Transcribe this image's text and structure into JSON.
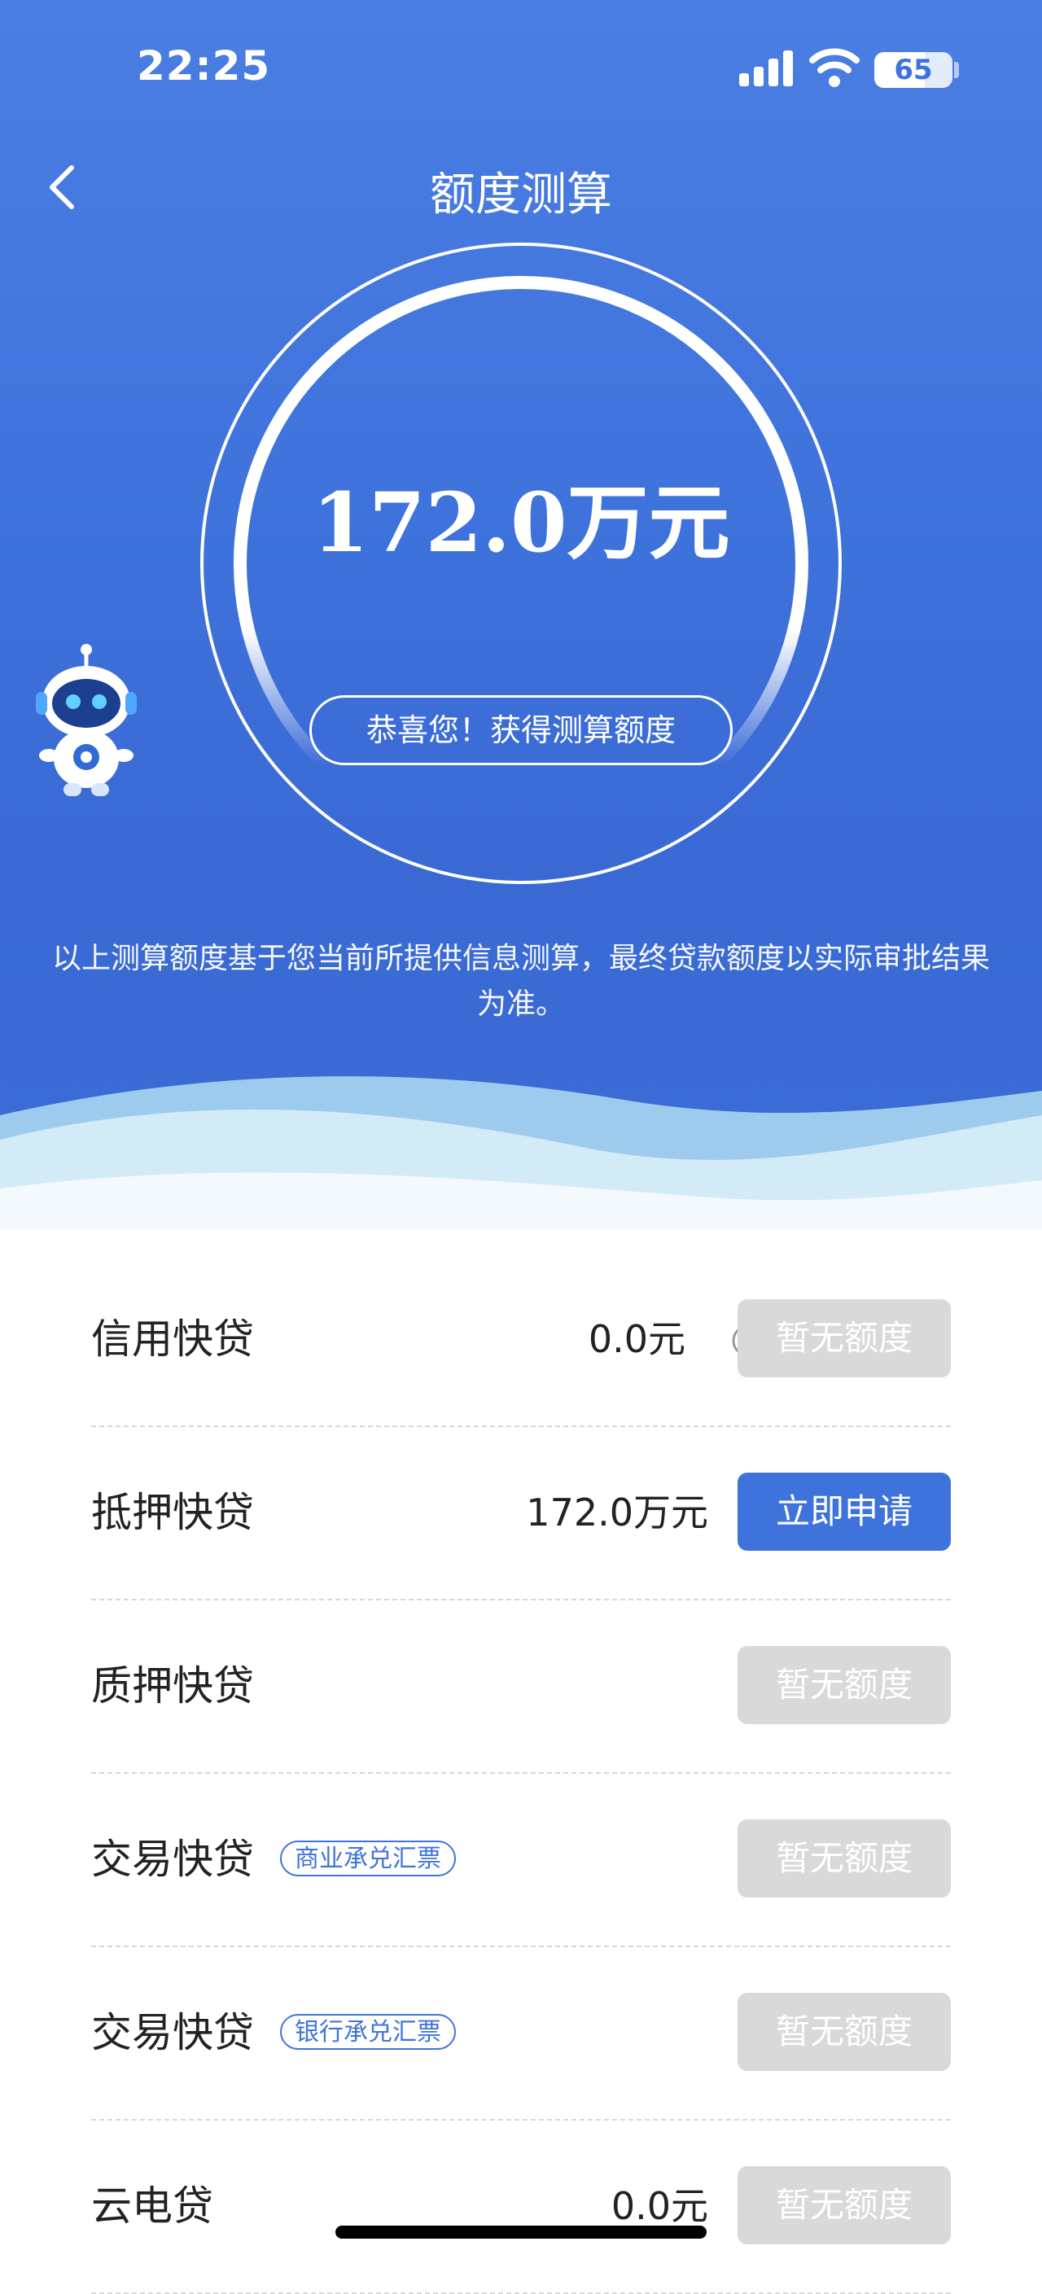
{
  "status_bar": {
    "time": "22:25",
    "battery": "65"
  },
  "nav": {
    "title": "额度测算"
  },
  "result": {
    "amount": "172.0万元",
    "message": "恭喜您！获得测算额度",
    "disclaimer": "以上测算额度基于您当前所提供信息测算，最终贷款额度以实际审批结果为准。"
  },
  "colors": {
    "primary": "#3f73dc",
    "disabled": "#d9d9d9"
  },
  "products": [
    {
      "name": "信用快贷",
      "tag": "",
      "amount": "0.0元",
      "has_info": true,
      "button": "暂无额度",
      "button_state": "disabled"
    },
    {
      "name": "抵押快贷",
      "tag": "",
      "amount": "172.0万元",
      "has_info": false,
      "button": "立即申请",
      "button_state": "primary"
    },
    {
      "name": "质押快贷",
      "tag": "",
      "amount": "",
      "has_info": false,
      "button": "暂无额度",
      "button_state": "disabled"
    },
    {
      "name": "交易快贷",
      "tag": "商业承兑汇票",
      "amount": "",
      "has_info": false,
      "button": "暂无额度",
      "button_state": "disabled"
    },
    {
      "name": "交易快贷",
      "tag": "银行承兑汇票",
      "amount": "",
      "has_info": false,
      "button": "暂无额度",
      "button_state": "disabled"
    },
    {
      "name": "云电贷",
      "tag": "",
      "amount": "0.0元",
      "has_info": false,
      "button": "暂无额度",
      "button_state": "disabled"
    }
  ]
}
